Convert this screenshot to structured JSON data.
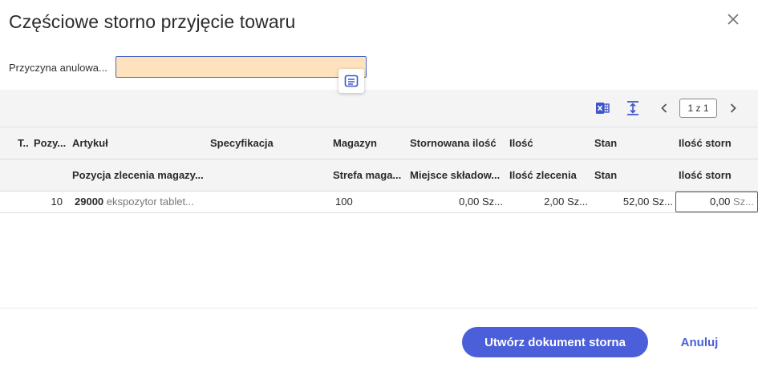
{
  "dialog": {
    "title": "Częściowe storno przyjęcie towaru",
    "close_icon": "close-icon"
  },
  "reason": {
    "label": "Przyczyna anulowa...",
    "value": "",
    "placeholder": "",
    "lookup_icon": "list-lookup-icon"
  },
  "toolbar": {
    "excel_icon": "excel-export-icon",
    "fit_icon": "row-height-icon",
    "prev_icon": "chevron-left-icon",
    "page_label": "1 z 1",
    "next_icon": "chevron-right-icon"
  },
  "columns_row1": [
    "T..",
    "Pozy...",
    "Artykuł",
    "Specyfikacja",
    "Magazyn",
    "Stornowana ilość",
    "Ilość",
    "Stan",
    "Ilość storn"
  ],
  "columns_row2": [
    "Pozycja zlecenia magazy...",
    "Strefa maga...",
    "Miejsce składow...",
    "Ilość zlecenia",
    "Stan",
    "Ilość storn"
  ],
  "rows": [
    {
      "position": "10",
      "article_code": "29000",
      "article_name": "ekspozytor tablet...",
      "warehouse": "100",
      "storno_qty": "0,00 Sz...",
      "qty": "2,00 Sz...",
      "stock": "52,00 Sz...",
      "storno_input_value": "0,00",
      "storno_input_unit": "Sz..."
    }
  ],
  "footer": {
    "primary_label": "Utwórz dokument storna",
    "cancel_label": "Anuluj"
  },
  "colors": {
    "accent": "#4a5fd9",
    "input_highlight": "#fde2bd",
    "header_bg": "#f4f4f4"
  }
}
